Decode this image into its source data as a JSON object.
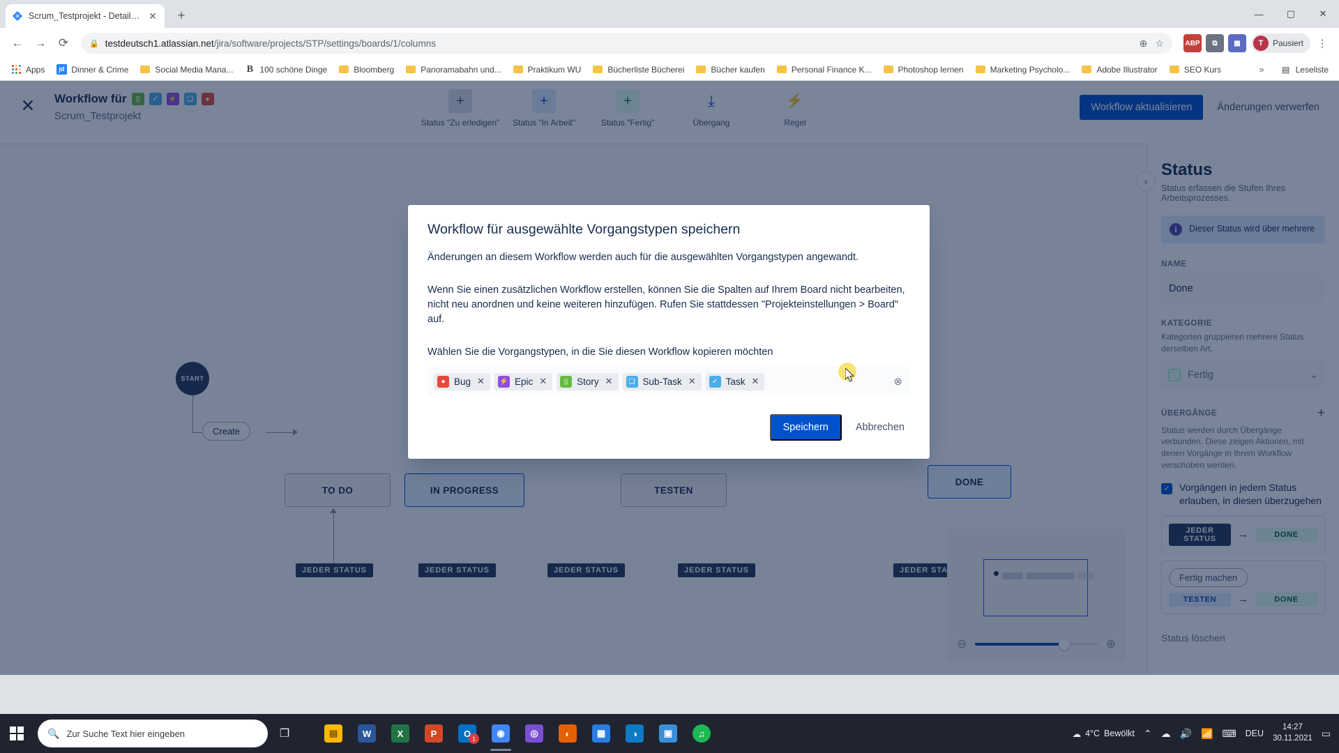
{
  "browser": {
    "tab": {
      "title": "Scrum_Testprojekt - Details - Jira",
      "favicon": "jira-icon",
      "close": "✕"
    },
    "new_tab_label": "+",
    "window_controls": {
      "minimize": "—",
      "maximize": "▢",
      "close": "✕"
    },
    "nav": {
      "back": "←",
      "forward": "→",
      "reload": "⟳"
    },
    "omnibox": {
      "lock": "🔒",
      "url_host": "testdeutsch1.atlassian.net",
      "url_path": "/jira/software/projects/STP/settings/boards/1/columns",
      "zoom_icon": "⊕",
      "star_icon": "☆"
    },
    "extensions": [
      {
        "name": "abp-extension",
        "label": "ABP",
        "color": "#c4403a"
      },
      {
        "name": "puzzle-extension",
        "label": "⧉",
        "color": "#6b7280"
      },
      {
        "name": "grid-extension",
        "label": "▦",
        "color": "#5c6ac4"
      }
    ],
    "profile": {
      "initial": "T",
      "label": "Pausiert"
    },
    "menu": "⋮",
    "bookmarks": {
      "apps_label": "Apps",
      "items": [
        {
          "label": "Dinner & Crime",
          "icon": "jd-icon",
          "color": "#2684ff"
        },
        {
          "label": "Social Media Mana...",
          "icon": "folder-icon"
        },
        {
          "label": "100 schöne Dinge",
          "icon": "b-icon"
        },
        {
          "label": "Bloomberg",
          "icon": "folder-icon"
        },
        {
          "label": "Panoramabahn und...",
          "icon": "folder-icon"
        },
        {
          "label": "Praktikum WU",
          "icon": "folder-icon"
        },
        {
          "label": "Bücherliste Bücherei",
          "icon": "folder-icon"
        },
        {
          "label": "Bücher kaufen",
          "icon": "folder-icon"
        },
        {
          "label": "Personal Finance K...",
          "icon": "folder-icon"
        },
        {
          "label": "Photoshop lernen",
          "icon": "folder-icon"
        },
        {
          "label": "Marketing Psycholo...",
          "icon": "folder-icon"
        },
        {
          "label": "Adobe Illustrator",
          "icon": "folder-icon"
        },
        {
          "label": "SEO Kurs",
          "icon": "folder-icon"
        }
      ],
      "overflow": "»",
      "reading_list": "Leseliste",
      "reading_list_icon": "list-icon"
    }
  },
  "workflow": {
    "close_icon": "✕",
    "title": "Workflow für",
    "subtitle": "Scrum_Testprojekt",
    "issue_types": [
      {
        "name": "story",
        "glyph": "▯",
        "color": "#65ba43"
      },
      {
        "name": "task",
        "glyph": "✓",
        "color": "#4bade8"
      },
      {
        "name": "epic",
        "glyph": "⚡",
        "color": "#904ee2"
      },
      {
        "name": "subtask",
        "glyph": "❏",
        "color": "#4bade8"
      },
      {
        "name": "bug",
        "glyph": "●",
        "color": "#e5493a"
      }
    ],
    "tools": [
      {
        "name": "add-todo-status",
        "glyph": "+",
        "label": "Status \"Zu erledigen\"",
        "color": "#42526e",
        "bg": "#dfe1e6"
      },
      {
        "name": "add-inprogress-status",
        "glyph": "+",
        "label": "Status \"In Arbeit\"",
        "color": "#0052cc",
        "bg": "#deebff"
      },
      {
        "name": "add-done-status",
        "glyph": "+",
        "label": "Status \"Fertig\"",
        "color": "#00875a",
        "bg": "#e3fcef"
      },
      {
        "name": "add-transition",
        "glyph": "⤓",
        "label": "Übergang",
        "color": "#0052cc",
        "bg": "transparent"
      },
      {
        "name": "add-rule",
        "glyph": "⚡",
        "label": "Regel",
        "color": "#253858",
        "bg": "transparent"
      }
    ],
    "actions": {
      "primary": "Workflow aktualisieren",
      "secondary": "Änderungen verwerfen"
    },
    "canvas": {
      "start_label": "START",
      "create_label": "Create",
      "nodes": [
        {
          "label": "TO DO",
          "selected": false
        },
        {
          "label": "IN PROGRESS",
          "selected": false
        },
        {
          "label": "TESTEN",
          "selected": false
        },
        {
          "label": "DONE",
          "selected": true
        }
      ],
      "any_status_label": "JEDER STATUS",
      "any_status_count": 5
    },
    "minimap": {
      "zoom_out_icon": "zoom-out-icon",
      "zoom_in_icon": "zoom-in-icon",
      "zoom_value": 72
    }
  },
  "right_panel": {
    "expand_icon": "›",
    "heading": "Status",
    "subheading": "Status erfassen die Stufen Ihres Arbeitsprozesses.",
    "info_icon": "i",
    "info_text": "Dieser Status wird über mehrere Workflows hinweg g",
    "name_label": "NAME",
    "name_value": "Done",
    "category_label": "KATEGORIE",
    "category_help": "Kategorien gruppieren mehrere Status derselben Art.",
    "category_value": "Fertig",
    "category_chevron": "⌄",
    "transitions_label": "ÜBERGÄNGE",
    "transitions_add_icon": "+",
    "transitions_help": "Status werden durch Übergänge verbunden. Diese zeigen Aktionen, mit denen Vorgänge in Ihrem Workflow verschoben werden.",
    "allow_all_checkbox": {
      "checked": true,
      "glyph": "✓",
      "label": "Vorgängen in jedem Status erlauben, in diesen überzugehen"
    },
    "transition_rows": [
      {
        "from": "JEDER STATUS",
        "from_style": "dark",
        "arrow": "→",
        "to": "DONE",
        "to_style": "green",
        "pill": null
      },
      {
        "from": "TESTEN",
        "from_style": "blue",
        "arrow": "→",
        "to": "DONE",
        "to_style": "green",
        "pill": "Fertig machen"
      }
    ],
    "delete_label": "Status löschen"
  },
  "modal": {
    "title": "Workflow für ausgewählte Vorgangstypen speichern",
    "paragraph1": "Änderungen an diesem Workflow werden auch für die ausgewählten Vorgangstypen angewandt.",
    "paragraph2": "Wenn Sie einen zusätzlichen Workflow erstellen, können Sie die Spalten auf Ihrem Board nicht bearbeiten, nicht neu anordnen und keine weiteren hinzufügen. Rufen Sie stattdessen \"Projekteinstellungen > Board\" auf.",
    "paragraph3": "Wählen Sie die Vorgangstypen, in die Sie diesen Workflow kopieren möchten",
    "chips": [
      {
        "label": "Bug",
        "glyph": "●",
        "color": "#e5493a",
        "remove": "✕"
      },
      {
        "label": "Epic",
        "glyph": "⚡",
        "color": "#904ee2",
        "remove": "✕"
      },
      {
        "label": "Story",
        "glyph": "▯",
        "color": "#65ba43",
        "remove": "✕"
      },
      {
        "label": "Sub-Task",
        "glyph": "❏",
        "color": "#4bade8",
        "remove": "✕"
      },
      {
        "label": "Task",
        "glyph": "✓",
        "color": "#4bade8",
        "remove": "✕"
      }
    ],
    "clear_icon": "⊗",
    "save_label": "Speichern",
    "cancel_label": "Abbrechen"
  },
  "taskbar": {
    "start_icon": "windows-icon",
    "search": {
      "icon": "search-icon",
      "placeholder": "Zur Suche Text hier eingeben"
    },
    "task_view_icon": "task-view-icon",
    "apps": [
      {
        "name": "file-explorer",
        "glyph": "▤",
        "color": "#ffb900",
        "badge": null,
        "active": false
      },
      {
        "name": "word",
        "glyph": "W",
        "color": "#2b579a",
        "badge": null,
        "active": false
      },
      {
        "name": "excel",
        "glyph": "X",
        "color": "#217346",
        "badge": null,
        "active": false
      },
      {
        "name": "powerpoint",
        "glyph": "P",
        "color": "#d24726",
        "badge": null,
        "active": false
      },
      {
        "name": "outlook",
        "glyph": "O",
        "color": "#0072c6",
        "badge": "1",
        "active": false
      },
      {
        "name": "chrome",
        "glyph": "◉",
        "color": "#4285f4",
        "badge": null,
        "active": true
      },
      {
        "name": "cd-app",
        "glyph": "◎",
        "color": "#7a4fd4",
        "badge": null,
        "active": false
      },
      {
        "name": "firefox",
        "glyph": "◐",
        "color": "#e66000",
        "badge": null,
        "active": false
      },
      {
        "name": "paint",
        "glyph": "🖌",
        "color": "#2a7de1",
        "badge": null,
        "active": false
      },
      {
        "name": "edge",
        "glyph": "◑",
        "color": "#0e7ac4",
        "badge": null,
        "active": false
      },
      {
        "name": "photos",
        "glyph": "▣",
        "color": "#3a8fd8",
        "badge": null,
        "active": false
      },
      {
        "name": "spotify",
        "glyph": "♫",
        "color": "#1db954",
        "badge": null,
        "active": false
      }
    ],
    "weather": {
      "icon": "cloud-icon",
      "temp": "4°C",
      "desc": "Bewölkt"
    },
    "tray_icons": [
      "chevron-up-icon",
      "onedrive-icon",
      "volume-icon",
      "wifi-icon",
      "keyboard-icon"
    ],
    "language": "DEU",
    "time": "14:27",
    "date": "30.11.2021",
    "notifications_icon": "notification-icon"
  }
}
